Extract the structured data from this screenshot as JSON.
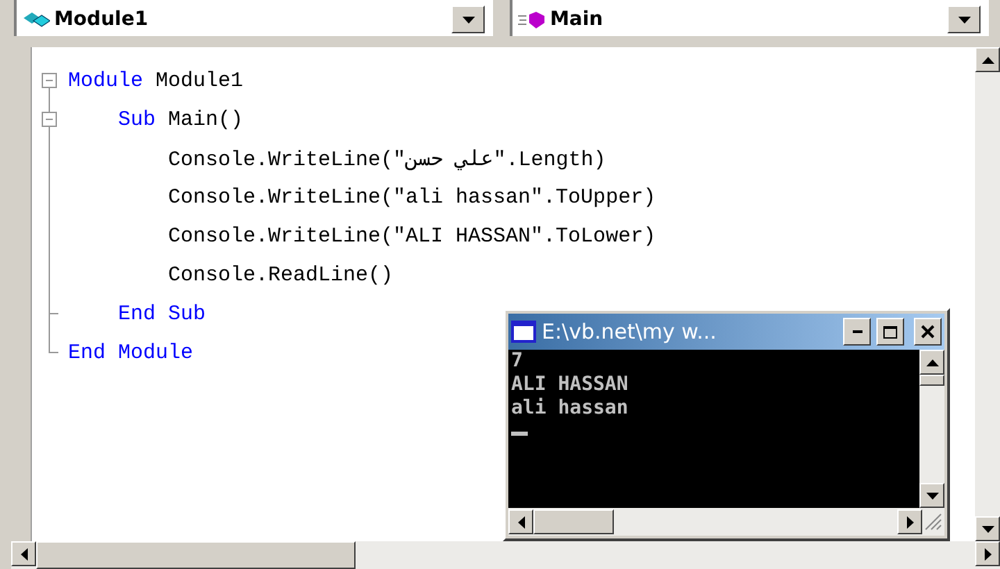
{
  "combos": [
    {
      "label": "Module1"
    },
    {
      "label": "Main"
    }
  ],
  "code_lines": [
    {
      "kind": "start",
      "tokens": [
        {
          "text": "Module",
          "kind": "keyword"
        },
        {
          "text": " Module1",
          "kind": "plain"
        }
      ]
    },
    {
      "kind": "start",
      "tokens": [
        {
          "text": "    Sub",
          "kind": "keyword"
        },
        {
          "text": " Main()",
          "kind": "plain"
        }
      ]
    },
    {
      "kind": "inner",
      "tokens": [
        {
          "text": "        Console.WriteLine(\"علي حسن\".Length)",
          "kind": "plain"
        }
      ]
    },
    {
      "kind": "inner",
      "tokens": [
        {
          "text": "        Console.WriteLine(\"ali hassan\".ToUpper)",
          "kind": "plain"
        }
      ]
    },
    {
      "kind": "inner",
      "tokens": [
        {
          "text": "        Console.WriteLine(\"ALI HASSAN\".ToLower)",
          "kind": "plain"
        }
      ]
    },
    {
      "kind": "inner",
      "tokens": [
        {
          "text": "        Console.ReadLine()",
          "kind": "plain"
        }
      ]
    },
    {
      "kind": "branch",
      "tokens": [
        {
          "text": "    End Sub",
          "kind": "keyword"
        }
      ]
    },
    {
      "kind": "last",
      "tokens": [
        {
          "text": "End Module",
          "kind": "keyword"
        }
      ]
    }
  ],
  "console": {
    "title": "E:\\vb.net\\my w...",
    "lines": [
      "7",
      "ALI HASSAN",
      "ali hassan"
    ]
  }
}
